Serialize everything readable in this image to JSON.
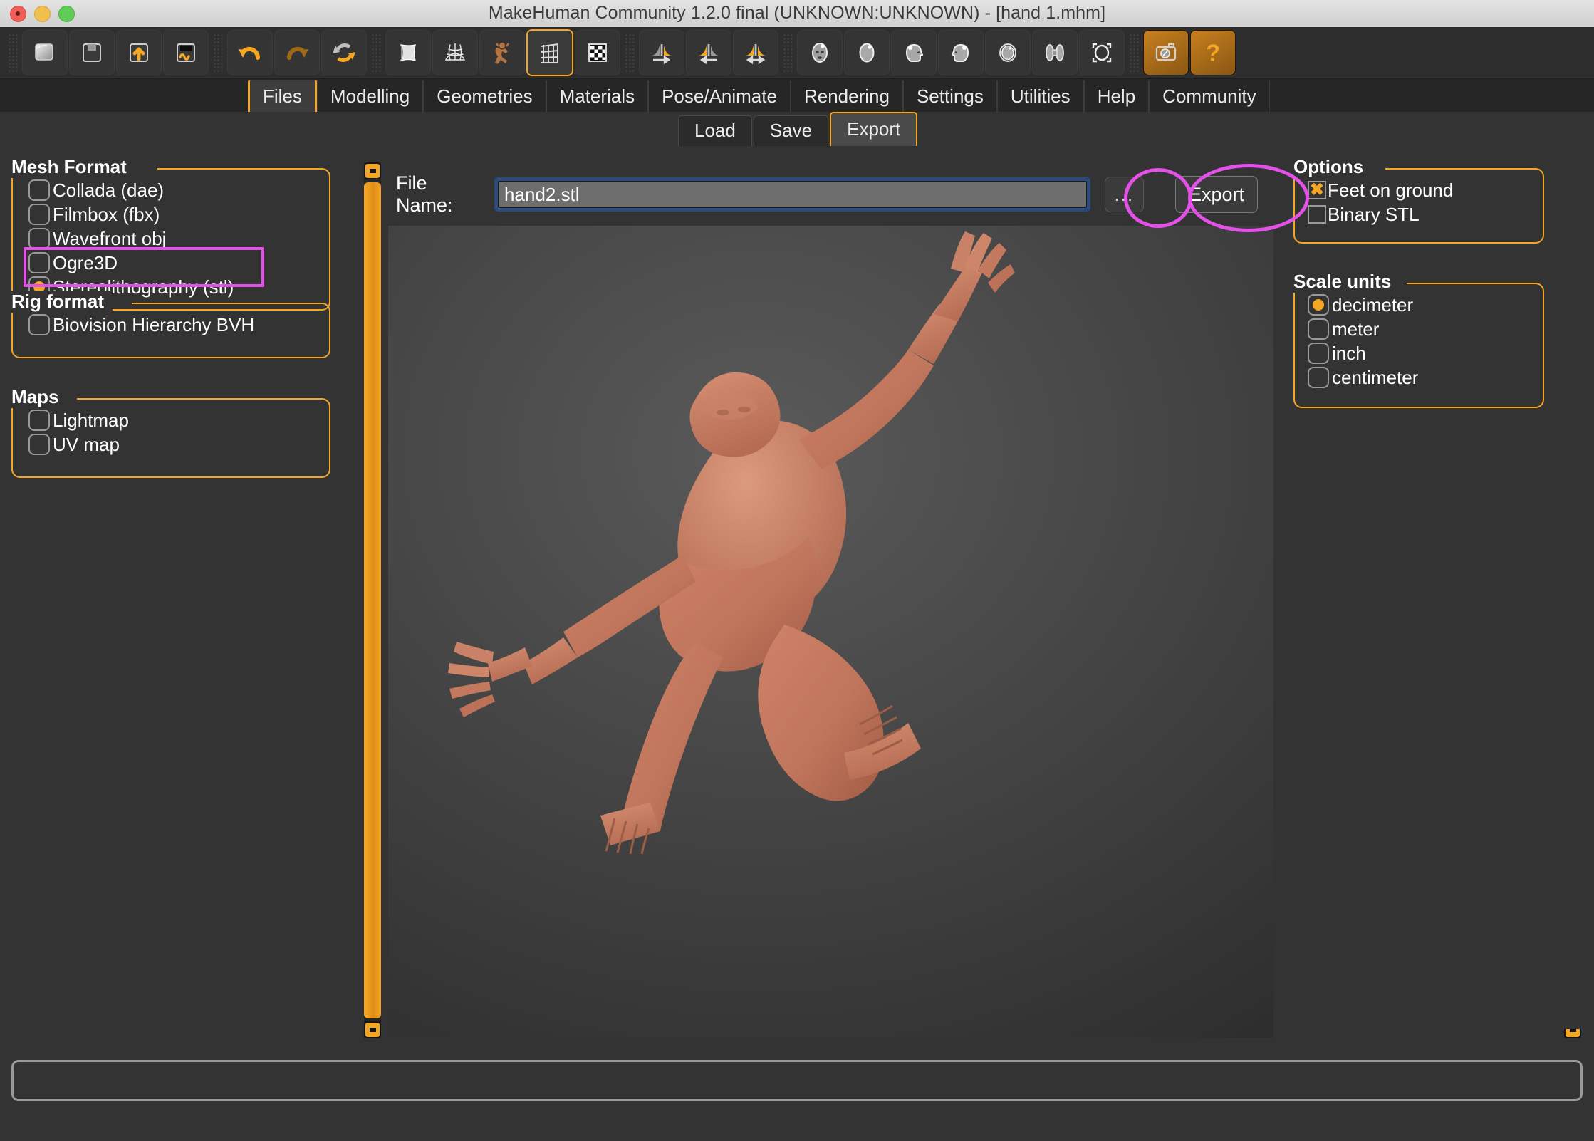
{
  "window": {
    "title": "MakeHuman Community 1.2.0 final (UNKNOWN:UNKNOWN) - [hand 1.mhm]",
    "traffic_lights": [
      "close-button",
      "minimize-button",
      "zoom-button"
    ]
  },
  "toolbar": {
    "groups": [
      {
        "icons": [
          "new-document-icon",
          "save-document-icon",
          "load-document-icon",
          "save-as-icon"
        ]
      },
      {
        "icons": [
          "undo-icon",
          "redo-icon",
          "reset-mesh-icon"
        ]
      },
      {
        "icons": [
          "smooth-shading-icon",
          "wireframe-globe-icon",
          "pose-figure-icon",
          "grid-icon",
          "checker-texture-icon"
        ]
      },
      {
        "icons": [
          "symmetry-right-icon",
          "symmetry-left-icon",
          "symmetry-both-icon"
        ]
      },
      {
        "icons": [
          "view-front-face-icon",
          "view-top-head-icon",
          "view-side-head-icon",
          "view-back-head-icon",
          "view-top-icon",
          "view-side-pair-icon",
          "view-frame-icon"
        ]
      },
      {
        "icons": [
          "grab-screen-icon",
          "help-icon"
        ]
      }
    ]
  },
  "main_tabs": {
    "items": [
      {
        "label": "Files",
        "active": true
      },
      {
        "label": "Modelling",
        "active": false
      },
      {
        "label": "Geometries",
        "active": false
      },
      {
        "label": "Materials",
        "active": false
      },
      {
        "label": "Pose/Animate",
        "active": false
      },
      {
        "label": "Rendering",
        "active": false
      },
      {
        "label": "Settings",
        "active": false
      },
      {
        "label": "Utilities",
        "active": false
      },
      {
        "label": "Help",
        "active": false
      },
      {
        "label": "Community",
        "active": false
      }
    ]
  },
  "sub_tabs": {
    "items": [
      {
        "label": "Load",
        "active": false
      },
      {
        "label": "Save",
        "active": false
      },
      {
        "label": "Export",
        "active": true
      }
    ]
  },
  "left_panel": {
    "groups": [
      {
        "title": "Mesh Format",
        "type": "radio",
        "options": [
          {
            "label": "Collada (dae)",
            "selected": false
          },
          {
            "label": "Filmbox (fbx)",
            "selected": false
          },
          {
            "label": "Wavefront obj",
            "selected": false
          },
          {
            "label": "Ogre3D",
            "selected": false
          },
          {
            "label": "Stereolithography (stl)",
            "selected": true,
            "highlighted": true
          }
        ]
      },
      {
        "title": "Rig format",
        "type": "radio",
        "options": [
          {
            "label": "Biovision Hierarchy BVH",
            "selected": false
          }
        ]
      },
      {
        "title": "Maps",
        "type": "radio",
        "options": [
          {
            "label": "Lightmap",
            "selected": false
          },
          {
            "label": "UV map",
            "selected": false
          }
        ]
      }
    ]
  },
  "file_row": {
    "label": "File Name:",
    "value": "hand2.stl",
    "placeholder": "",
    "browse_label": "...",
    "export_label": "Export",
    "browse_highlighted": true,
    "export_highlighted": true
  },
  "right_panel": {
    "groups": [
      {
        "title": "Options",
        "type": "checkbox",
        "options": [
          {
            "label": "Feet on ground",
            "checked": true
          },
          {
            "label": "Binary STL",
            "checked": false
          }
        ]
      },
      {
        "title": "Scale units",
        "type": "radio",
        "options": [
          {
            "label": "decimeter",
            "selected": true
          },
          {
            "label": "meter",
            "selected": false
          },
          {
            "label": "inch",
            "selected": false
          },
          {
            "label": "centimeter",
            "selected": false
          }
        ]
      }
    ]
  },
  "viewport": {
    "name": "3d-model-viewport",
    "model_color": "#c3785f",
    "background_top": "#5a5a5a",
    "background_bottom": "#232323"
  },
  "status_bar": {
    "text": ""
  },
  "colors": {
    "accent": "#f5a623",
    "highlight": "#e451e8",
    "panel_bg": "#333333",
    "focus_blue": "#2a4b7c"
  }
}
